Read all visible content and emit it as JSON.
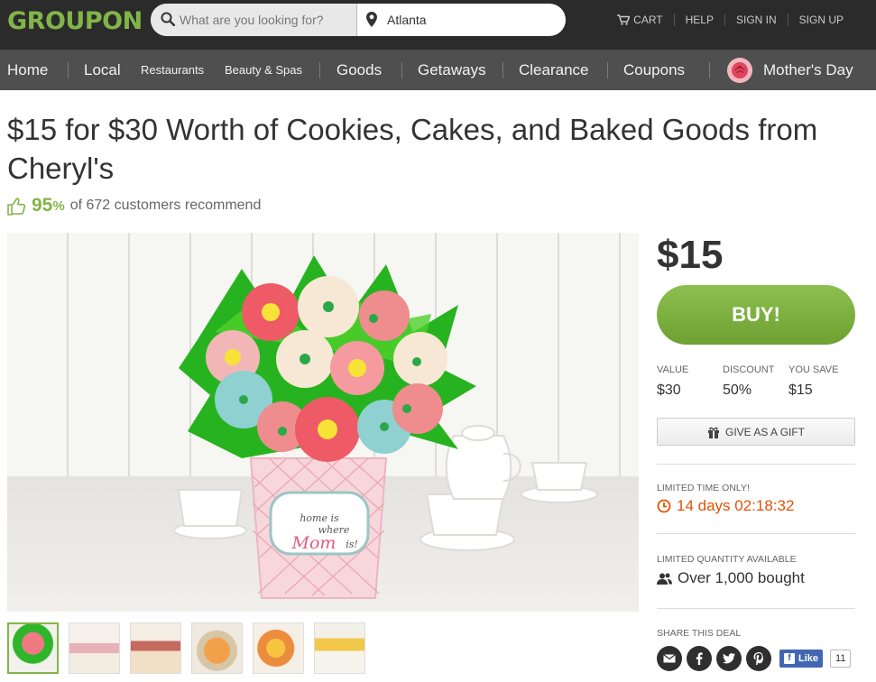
{
  "header": {
    "logo": "GROUPON",
    "search_placeholder": "What are you looking for?",
    "location_value": "Atlanta",
    "links": [
      "CART",
      "HELP",
      "SIGN IN",
      "SIGN UP"
    ]
  },
  "nav": {
    "items": [
      "Home",
      "Local",
      "Restaurants",
      "Beauty & Spas",
      "Goods",
      "Getaways",
      "Clearance",
      "Coupons",
      "Mother's Day"
    ]
  },
  "deal": {
    "title": "$15 for $30 Worth of Cookies, Cakes, and Baked Goods from Cheryl's",
    "recommend_pct": "95",
    "recommend_pct_sign": "%",
    "recommend_text": "of 672 customers recommend",
    "image_label_line1": "home is",
    "image_label_line2": "where",
    "image_label_line3": "Mom",
    "image_label_line4": "is!"
  },
  "purchase": {
    "price": "$15",
    "buy_label": "BUY!",
    "value_label": "VALUE",
    "value": "$30",
    "discount_label": "DISCOUNT",
    "discount": "50%",
    "save_label": "YOU SAVE",
    "save": "$15",
    "gift_label": "GIVE AS A GIFT",
    "limited_time_label": "LIMITED TIME ONLY!",
    "countdown": "14 days 02:18:32",
    "limited_qty_label": "LIMITED QUANTITY AVAILABLE",
    "bought": "Over 1,000 bought",
    "share_label": "SHARE THIS DEAL",
    "fb_like": "Like",
    "fb_count": "11"
  },
  "colors": {
    "brand_green": "#82b548",
    "topbar": "#2b2b2b",
    "navbar": "#4f4f4f",
    "countdown": "#e35205"
  }
}
